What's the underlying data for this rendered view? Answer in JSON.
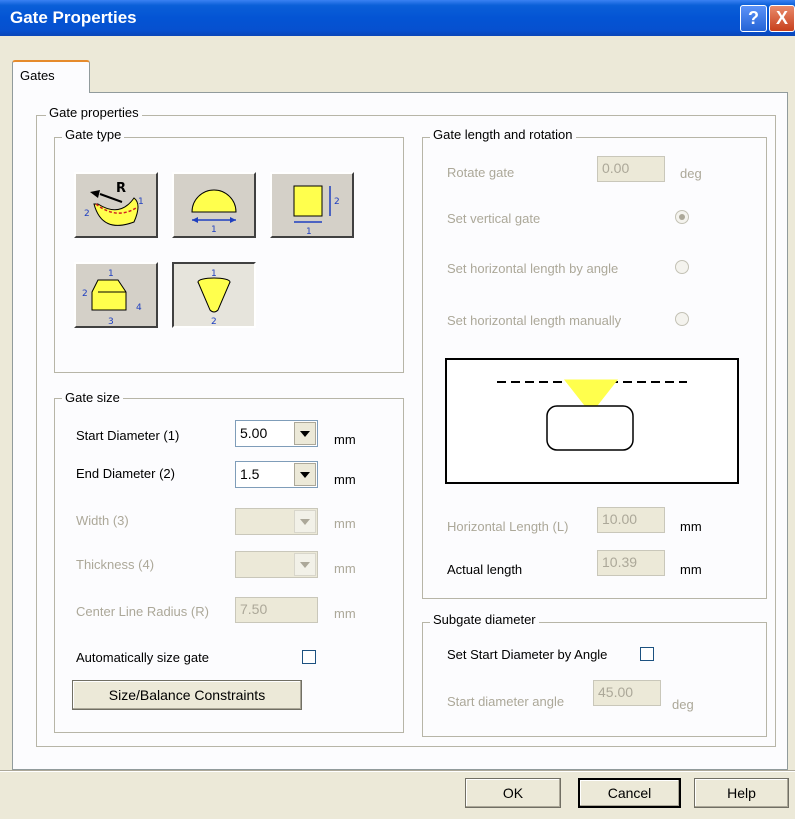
{
  "window": {
    "title": "Gate Properties",
    "help_glyph": "?",
    "close_glyph": "X"
  },
  "tabs": [
    {
      "label": "Gates",
      "selected": true
    }
  ],
  "gate_properties": {
    "label": "Gate properties",
    "gate_type": {
      "label": "Gate type",
      "types": [
        {
          "icon": "curved-gate-icon",
          "labels": [
            "R",
            "1",
            "2"
          ],
          "selected": false
        },
        {
          "icon": "half-round-gate-icon",
          "labels": [
            "1"
          ],
          "selected": false
        },
        {
          "icon": "rectangular-gate-icon",
          "labels": [
            "2",
            "1"
          ],
          "selected": false
        },
        {
          "icon": "trapezoidal-gate-icon",
          "labels": [
            "1",
            "2",
            "3",
            "4"
          ],
          "selected": false
        },
        {
          "icon": "conical-gate-icon",
          "labels": [
            "1",
            "2"
          ],
          "selected": true
        }
      ]
    },
    "gate_size": {
      "label": "Gate size",
      "start_diameter": {
        "label": "Start Diameter (1)",
        "value": "5.00",
        "unit": "mm"
      },
      "end_diameter": {
        "label": "End Diameter (2)",
        "value": "1.5",
        "unit": "mm"
      },
      "width": {
        "label": "Width (3)",
        "value": "",
        "unit": "mm",
        "enabled": false
      },
      "thickness": {
        "label": "Thickness (4)",
        "value": "",
        "unit": "mm",
        "enabled": false
      },
      "center_line_radius": {
        "label": "Center Line Radius (R)",
        "value": "7.50",
        "unit": "mm",
        "enabled": false
      },
      "auto_size": {
        "label": "Automatically size gate",
        "checked": false
      },
      "constraints_button": "Size/Balance Constraints"
    },
    "gate_length_rotation": {
      "label": "Gate length and rotation",
      "rotate_gate": {
        "label": "Rotate gate",
        "value": "0.00",
        "unit": "deg",
        "enabled": false
      },
      "vertical_gate": {
        "label": "Set vertical gate",
        "selected": true
      },
      "horizontal_by_angle": {
        "label": "Set horizontal length by angle",
        "selected": false
      },
      "horizontal_manual": {
        "label": "Set horizontal length manually",
        "selected": false
      },
      "horizontal_length": {
        "label": "Horizontal Length (L)",
        "value": "10.00",
        "unit": "mm",
        "enabled": false
      },
      "actual_length": {
        "label": "Actual length",
        "value": "10.39",
        "unit": "mm"
      }
    },
    "subgate": {
      "label": "Subgate diameter",
      "set_by_angle": {
        "label": "Set Start Diameter by Angle",
        "checked": false
      },
      "start_angle": {
        "label": "Start diameter angle",
        "value": "45.00",
        "unit": "deg",
        "enabled": false
      }
    }
  },
  "footer": {
    "ok": "OK",
    "cancel": "Cancel",
    "help": "Help"
  },
  "colors": {
    "titlebar": "#0454d4",
    "gate_fill": "#ffff4d",
    "arrow_blue": "#1f3fbf"
  }
}
